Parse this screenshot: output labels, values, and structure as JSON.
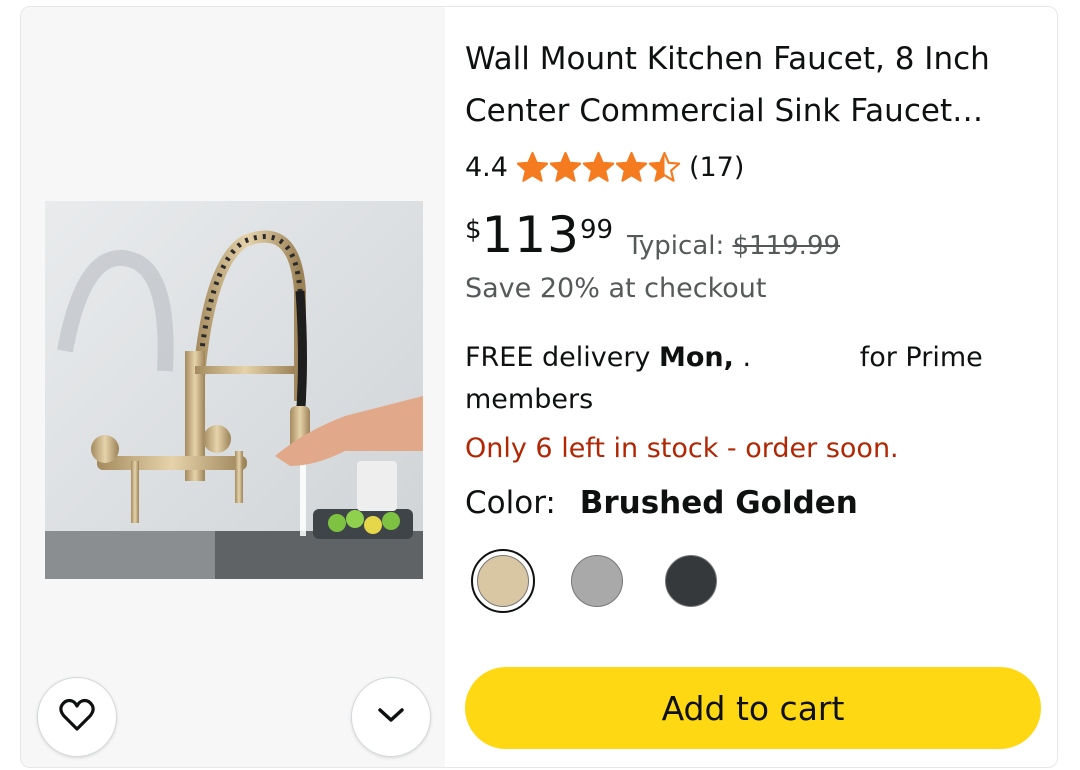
{
  "product": {
    "title": "Wall Mount Kitchen Faucet, 8 Inch Center Commercial Sink Faucet…",
    "rating": "4.4",
    "review_count": "(17)",
    "stars_value": 4.5
  },
  "price": {
    "symbol": "$",
    "whole": "113",
    "fraction": "99",
    "typical_label": "Typical:",
    "typical_price": "$119.99",
    "save_text": "Save 20% at checkout"
  },
  "delivery": {
    "prefix": "FREE delivery",
    "day": "Mon,",
    "cont": ".",
    "suffix": "for Prime",
    "suffix2": "members"
  },
  "stock_text": "Only 6 left in stock - order soon.",
  "color": {
    "label": "Color:",
    "value": "Brushed Golden",
    "swatches": [
      "#d9c7a3",
      "#a9a9a9",
      "#36393c"
    ]
  },
  "add_to_cart_label": "Add to cart",
  "icons": {
    "wishlist": "heart-icon",
    "expand": "chevron-down-icon",
    "star": "star-icon"
  },
  "colors": {
    "star": "#f47b20",
    "button": "#ffd814",
    "stock": "#b12704"
  }
}
